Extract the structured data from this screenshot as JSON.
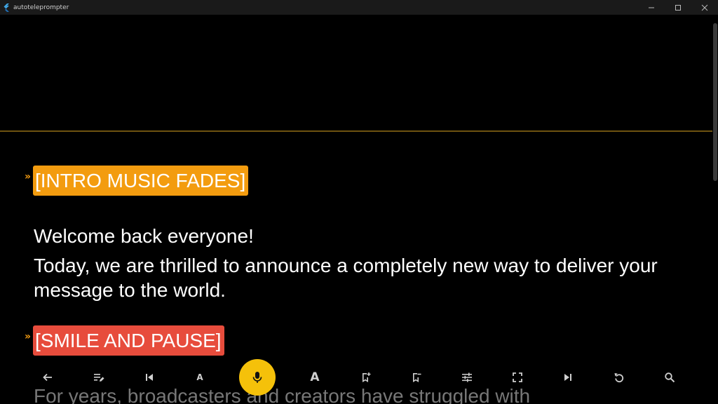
{
  "window": {
    "title": "autoteleprompter",
    "minimize_icon": "minimize-icon",
    "maximize_icon": "maximize-icon",
    "close_icon": "close-icon"
  },
  "colors": {
    "cue_orange": "#f39c0f",
    "cue_red": "#e74c3c",
    "mic_accent": "#f5c10a",
    "guide_line": "#6e5310"
  },
  "script": {
    "cue_marker": "»",
    "cue1": "[INTRO MUSIC FADES]",
    "para1": "Welcome back everyone!",
    "para2": "Today, we are thrilled to announce a completely new way to deliver your message to the world.",
    "cue2": "[SMILE AND PAUSE]",
    "para3": "For years, broadcasters and creators have struggled with"
  },
  "toolbar": {
    "buttons": [
      {
        "icon": "arrow-back-icon"
      },
      {
        "icon": "edit-text-icon"
      },
      {
        "icon": "skip-previous-icon"
      },
      {
        "icon": "font-smaller-icon",
        "label": "A"
      },
      {
        "icon": "microphone-icon"
      },
      {
        "icon": "font-larger-icon",
        "label": "A"
      },
      {
        "icon": "bookmark-add-icon"
      },
      {
        "icon": "bookmark-remove-icon"
      },
      {
        "icon": "tune-icon"
      },
      {
        "icon": "fullscreen-icon"
      },
      {
        "icon": "skip-next-icon"
      },
      {
        "icon": "reset-icon"
      },
      {
        "icon": "search-icon"
      }
    ]
  }
}
